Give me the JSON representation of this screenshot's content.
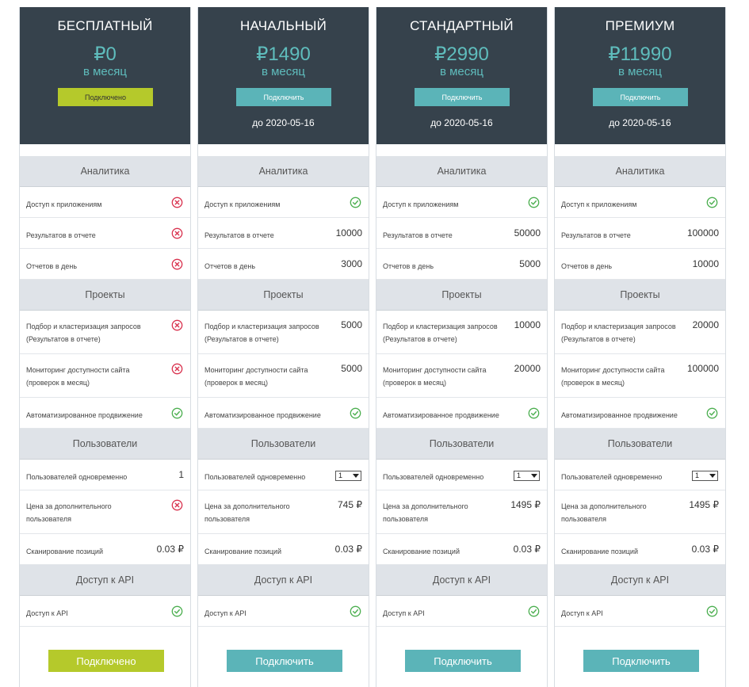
{
  "sections": {
    "analytics": "Аналитика",
    "projects": "Проекты",
    "users": "Пользователи",
    "api": "Доступ к API"
  },
  "labels": {
    "app_access": "Доступ к приложениям",
    "results_in_report": "Результатов в отчете",
    "reports_per_day": "Отчетов в день",
    "clustering_line1": "Подбор и кластеризация запросов",
    "clustering_line2": "(Результатов в отчете)",
    "monitoring_line1": "Мониторинг доступности сайта",
    "monitoring_line2": "(проверок в месяц)",
    "auto_promotion": "Автоматизированное продвижение",
    "simultaneous_users": "Пользователей одновременно",
    "extra_user_price_line1": "Цена за дополнительного",
    "extra_user_price_line2": "пользователя",
    "position_scan": "Сканирование позиций",
    "api_access": "Доступ к API"
  },
  "icons": {
    "yes": "check-circle-icon",
    "no": "cross-circle-icon"
  },
  "colors": {
    "header_bg": "#36424c",
    "price_teal": "#5fbdbd",
    "active_green": "#b5c92b",
    "subscribe_teal": "#5bb4b8",
    "check_green": "#4caf50",
    "cross_red": "#d9334f"
  },
  "plans": [
    {
      "name": "БЕСПЛАТНЫЙ",
      "price": "₽0",
      "period": "в месяц",
      "button_label": "Подключено",
      "button_state": "active",
      "until": "",
      "app_access": "no",
      "results_in_report": "",
      "reports_per_day": "",
      "clustering": "",
      "monitoring": "",
      "auto_promotion": "yes",
      "simultaneous_users": "1",
      "extra_user_price": "",
      "position_scan": "0.03 ₽",
      "api_access": "yes",
      "footer_button": "Подключено"
    },
    {
      "name": "НАЧАЛЬНЫЙ",
      "price": "₽1490",
      "period": "в месяц",
      "button_label": "Подключить",
      "button_state": "subscribe",
      "until": "до 2020-05-16",
      "app_access": "yes",
      "results_in_report": "10000",
      "reports_per_day": "3000",
      "clustering": "5000",
      "monitoring": "5000",
      "auto_promotion": "yes",
      "simultaneous_users": "1",
      "extra_user_price": "745 ₽",
      "position_scan": "0.03 ₽",
      "api_access": "yes",
      "footer_button": "Подключить"
    },
    {
      "name": "СТАНДАРТНЫЙ",
      "price": "₽2990",
      "period": "в месяц",
      "button_label": "Подключить",
      "button_state": "subscribe",
      "until": "до 2020-05-16",
      "app_access": "yes",
      "results_in_report": "50000",
      "reports_per_day": "5000",
      "clustering": "10000",
      "monitoring": "20000",
      "auto_promotion": "yes",
      "simultaneous_users": "1",
      "extra_user_price": "1495 ₽",
      "position_scan": "0.03 ₽",
      "api_access": "yes",
      "footer_button": "Подключить"
    },
    {
      "name": "ПРЕМИУМ",
      "price": "₽11990",
      "period": "в месяц",
      "button_label": "Подключить",
      "button_state": "subscribe",
      "until": "до 2020-05-16",
      "app_access": "yes",
      "results_in_report": "100000",
      "reports_per_day": "10000",
      "clustering": "20000",
      "monitoring": "100000",
      "auto_promotion": "yes",
      "simultaneous_users": "1",
      "extra_user_price": "1495 ₽",
      "position_scan": "0.03 ₽",
      "api_access": "yes",
      "footer_button": "Подключить"
    }
  ]
}
